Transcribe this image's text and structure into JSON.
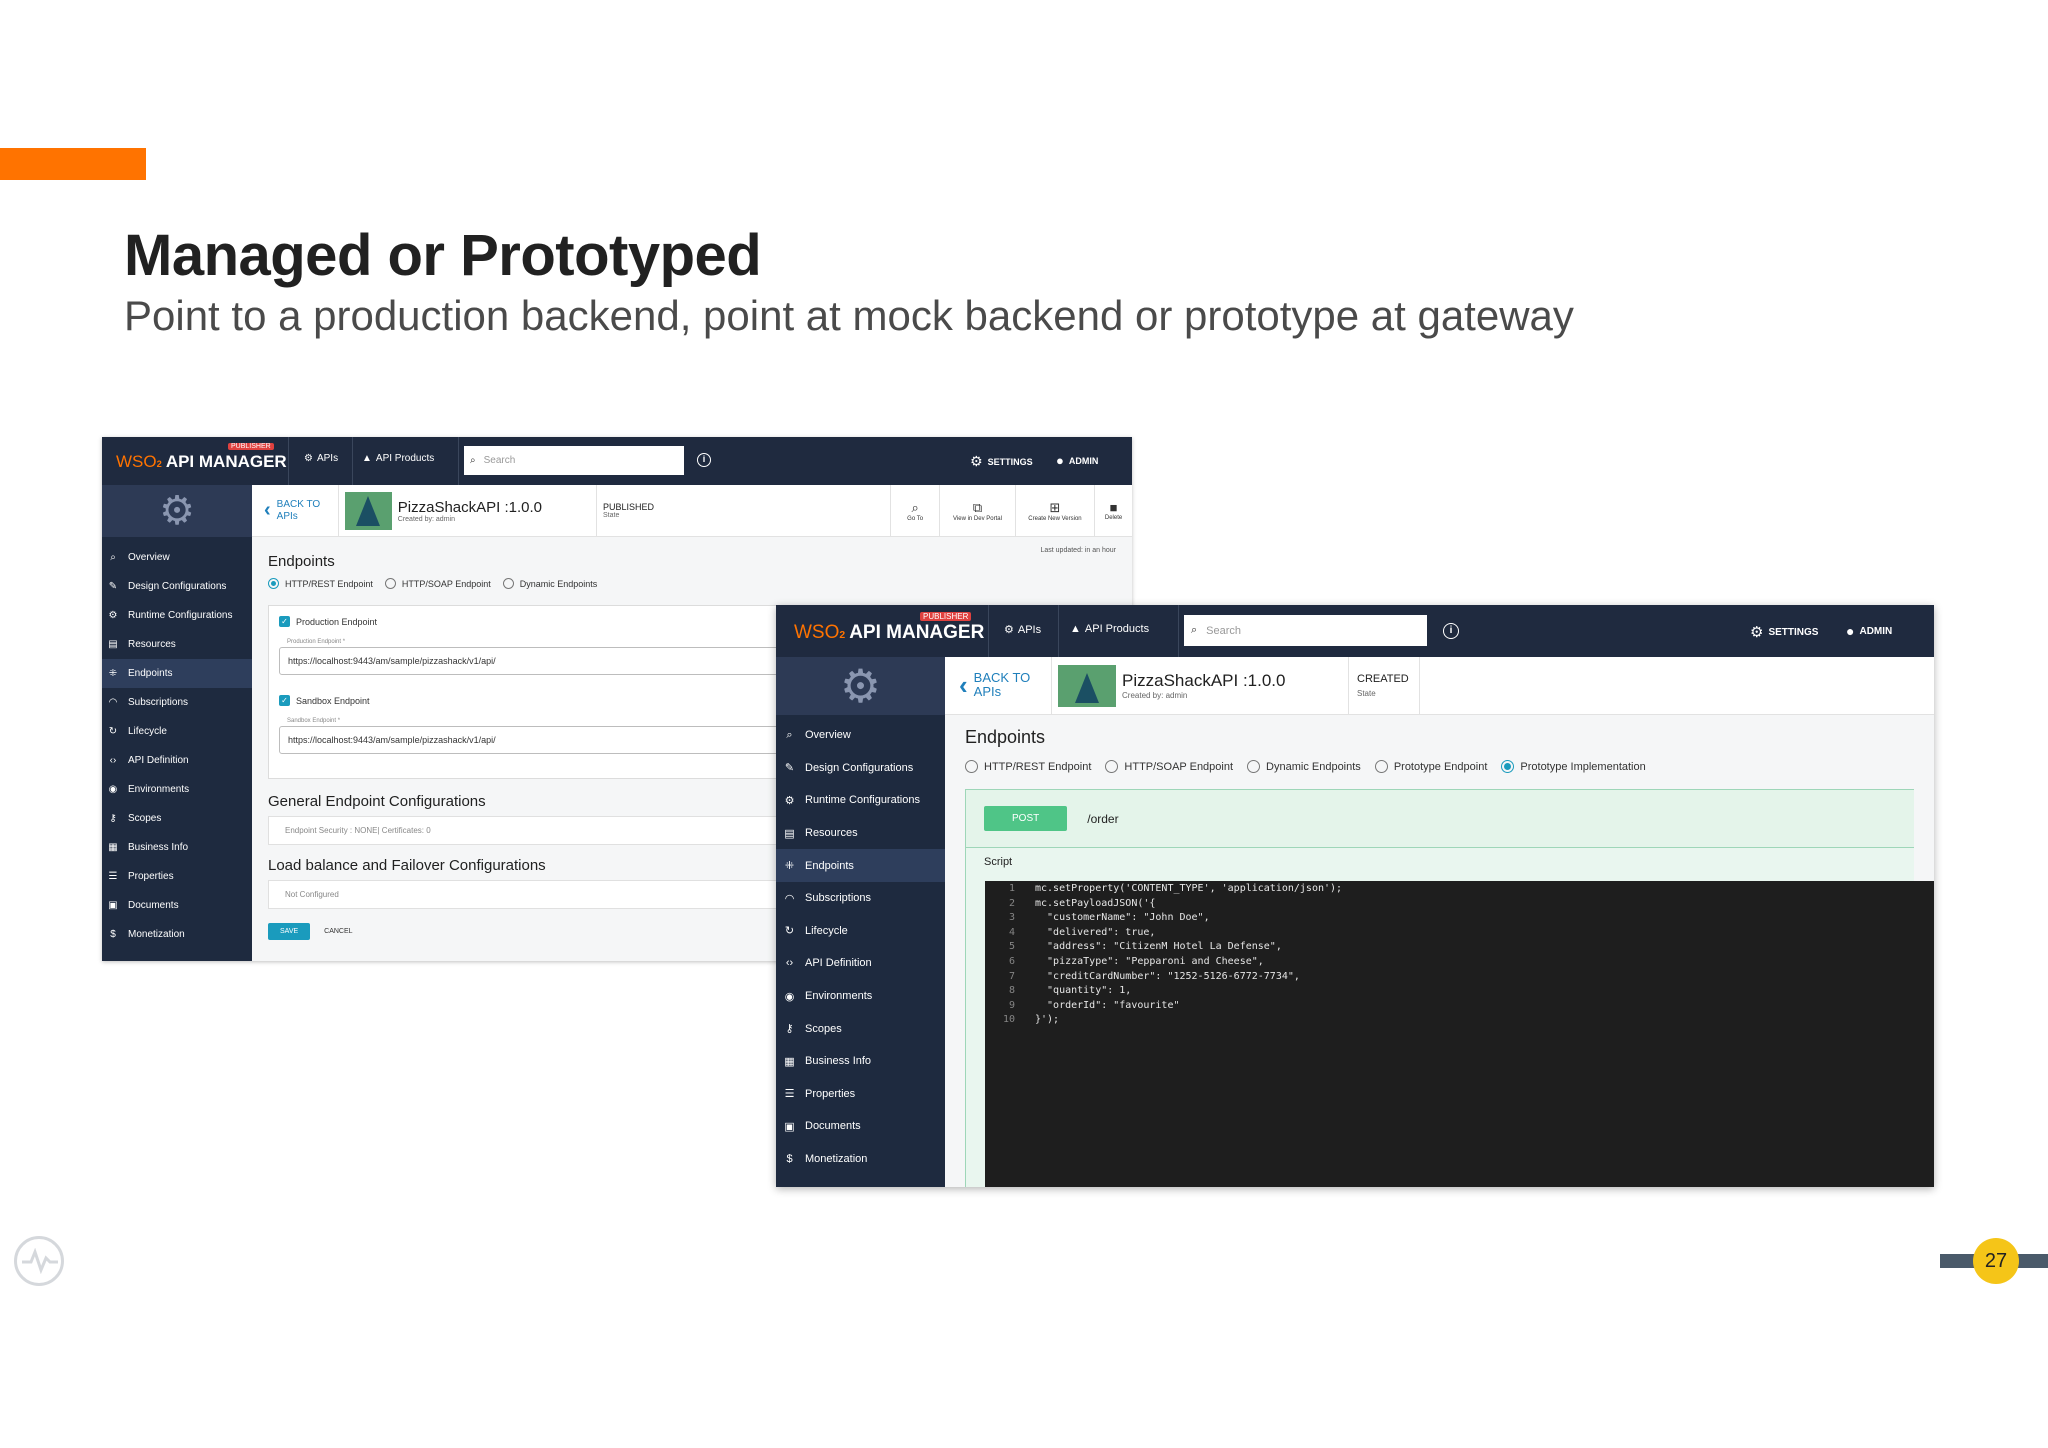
{
  "slide": {
    "title": "Managed or Prototyped",
    "subtitle": "Point to a production backend, point at mock backend or prototype at gateway",
    "page_number": "27",
    "accent_color": "#ff7300",
    "page_badge_color": "#f5c518"
  },
  "app": {
    "brand_wso": "WSO",
    "brand_two": "2",
    "brand_name": "API MANAGER",
    "publisher_badge": "PUBLISHER",
    "nav_apis": "APIs",
    "nav_api_products": "API Products",
    "search_placeholder": "Search",
    "settings": "SETTINGS",
    "admin": "ADMIN",
    "topbar_color": "#1f2a3f",
    "sidebar_color": "#1e2a3f"
  },
  "sidebar_items": [
    {
      "label": "Overview",
      "icon": "overview-icon"
    },
    {
      "label": "Design Configurations",
      "icon": "wrench-icon"
    },
    {
      "label": "Runtime Configurations",
      "icon": "gear-icon"
    },
    {
      "label": "Resources",
      "icon": "resources-icon"
    },
    {
      "label": "Endpoints",
      "icon": "endpoints-icon"
    },
    {
      "label": "Subscriptions",
      "icon": "rss-icon"
    },
    {
      "label": "Lifecycle",
      "icon": "refresh-icon"
    },
    {
      "label": "API Definition",
      "icon": "code-icon"
    },
    {
      "label": "Environments",
      "icon": "location-icon"
    },
    {
      "label": "Scopes",
      "icon": "key-icon"
    },
    {
      "label": "Business Info",
      "icon": "building-icon"
    },
    {
      "label": "Properties",
      "icon": "list-icon"
    },
    {
      "label": "Documents",
      "icon": "documents-icon"
    },
    {
      "label": "Monetization",
      "icon": "dollar-icon"
    }
  ],
  "managed": {
    "back_line1": "BACK TO",
    "back_line2": "APIs",
    "api_name": "PizzaShackAPI :1.0.0",
    "created_by": "Created by: admin",
    "state": "PUBLISHED",
    "state_label": "State",
    "actions": [
      "Go To",
      "View in Dev Portal",
      "Create New Version",
      "Delete"
    ],
    "last_updated": "Last updated: in an hour",
    "endpoints_heading": "Endpoints",
    "endpoint_types": [
      "HTTP/REST Endpoint",
      "HTTP/SOAP Endpoint",
      "Dynamic Endpoints"
    ],
    "selected_type": "HTTP/REST Endpoint",
    "production_label": "Production Endpoint",
    "production_field_label": "Production Endpoint *",
    "production_url": "https://localhost:9443/am/sample/pizzashack/v1/api/",
    "sandbox_label": "Sandbox Endpoint",
    "sandbox_field_label": "Sandbox Endpoint *",
    "sandbox_url": "https://localhost:9443/am/sample/pizzashack/v1/api/",
    "general_heading": "General Endpoint Configurations",
    "general_value": "Endpoint Security : NONE| Certificates: 0",
    "lb_heading": "Load balance and Failover Configurations",
    "lb_value": "Not Configured",
    "save": "SAVE",
    "cancel": "CANCEL"
  },
  "prototyped": {
    "back_line1": "BACK TO",
    "back_line2": "APIs",
    "api_name": "PizzaShackAPI :1.0.0",
    "created_by": "Created by: admin",
    "state": "CREATED",
    "state_label": "State",
    "endpoints_heading": "Endpoints",
    "endpoint_types": [
      "HTTP/REST Endpoint",
      "HTTP/SOAP Endpoint",
      "Dynamic Endpoints",
      "Prototype Endpoint",
      "Prototype Implementation"
    ],
    "selected_type": "Prototype Implementation",
    "method": "POST",
    "resource_path": "/order",
    "script_label": "Script",
    "code_lines": [
      {
        "n": "1",
        "text": "mc.setProperty('CONTENT_TYPE', 'application/json');"
      },
      {
        "n": "2",
        "text": "mc.setPayloadJSON('{"
      },
      {
        "n": "3",
        "text": "  \"customerName\": \"John Doe\","
      },
      {
        "n": "4",
        "text": "  \"delivered\": true,"
      },
      {
        "n": "5",
        "text": "  \"address\": \"CitizenM Hotel La Defense\","
      },
      {
        "n": "6",
        "text": "  \"pizzaType\": \"Pepparoni and Cheese\","
      },
      {
        "n": "7",
        "text": "  \"creditCardNumber\": \"1252-5126-6772-7734\","
      },
      {
        "n": "8",
        "text": "  \"quantity\": 1,"
      },
      {
        "n": "9",
        "text": "  \"orderId\": \"favourite\""
      },
      {
        "n": "10",
        "text": "}');"
      }
    ]
  }
}
